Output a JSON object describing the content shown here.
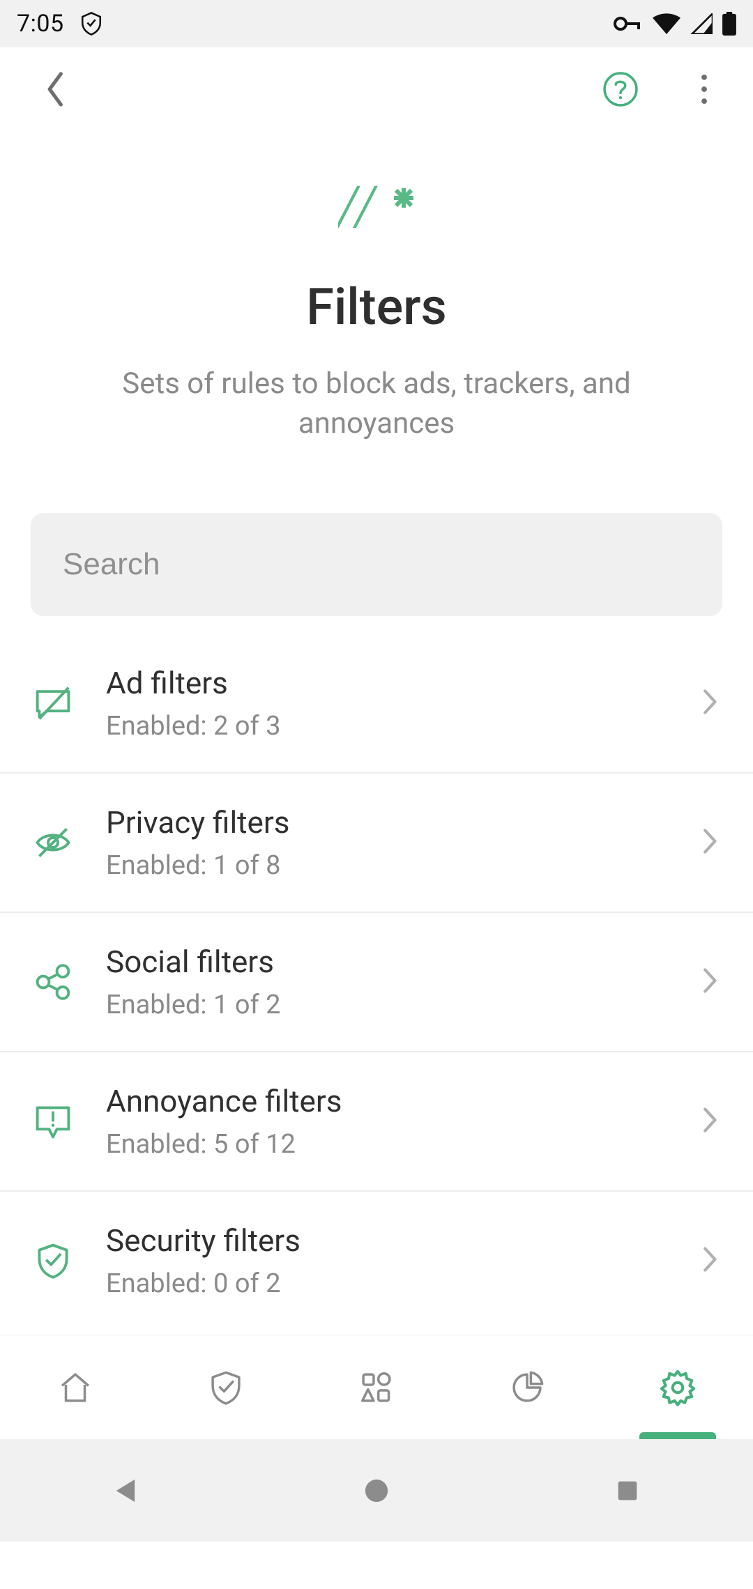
{
  "status": {
    "time": "7:05"
  },
  "colors": {
    "accent": "#53b280",
    "muted": "#8a8a8a"
  },
  "header": {
    "title": "Filters",
    "subtitle": "Sets of rules to block ads, trackers, and annoyances"
  },
  "search": {
    "placeholder": "Search",
    "value": ""
  },
  "filters": [
    {
      "icon": "message-slash-icon",
      "title": "Ad filters",
      "subtitle": "Enabled: 2 of 3"
    },
    {
      "icon": "eye-slash-icon",
      "title": "Privacy filters",
      "subtitle": "Enabled: 1 of 8"
    },
    {
      "icon": "share-nodes-icon",
      "title": "Social filters",
      "subtitle": "Enabled: 1 of 2"
    },
    {
      "icon": "annoyance-icon",
      "title": "Annoyance filters",
      "subtitle": "Enabled: 5 of 12"
    },
    {
      "icon": "shield-check-icon",
      "title": "Security filters",
      "subtitle": "Enabled: 0 of 2"
    }
  ],
  "bottomnav": {
    "items": [
      "home",
      "protection",
      "apps",
      "stats",
      "settings"
    ],
    "active_index": 4
  }
}
